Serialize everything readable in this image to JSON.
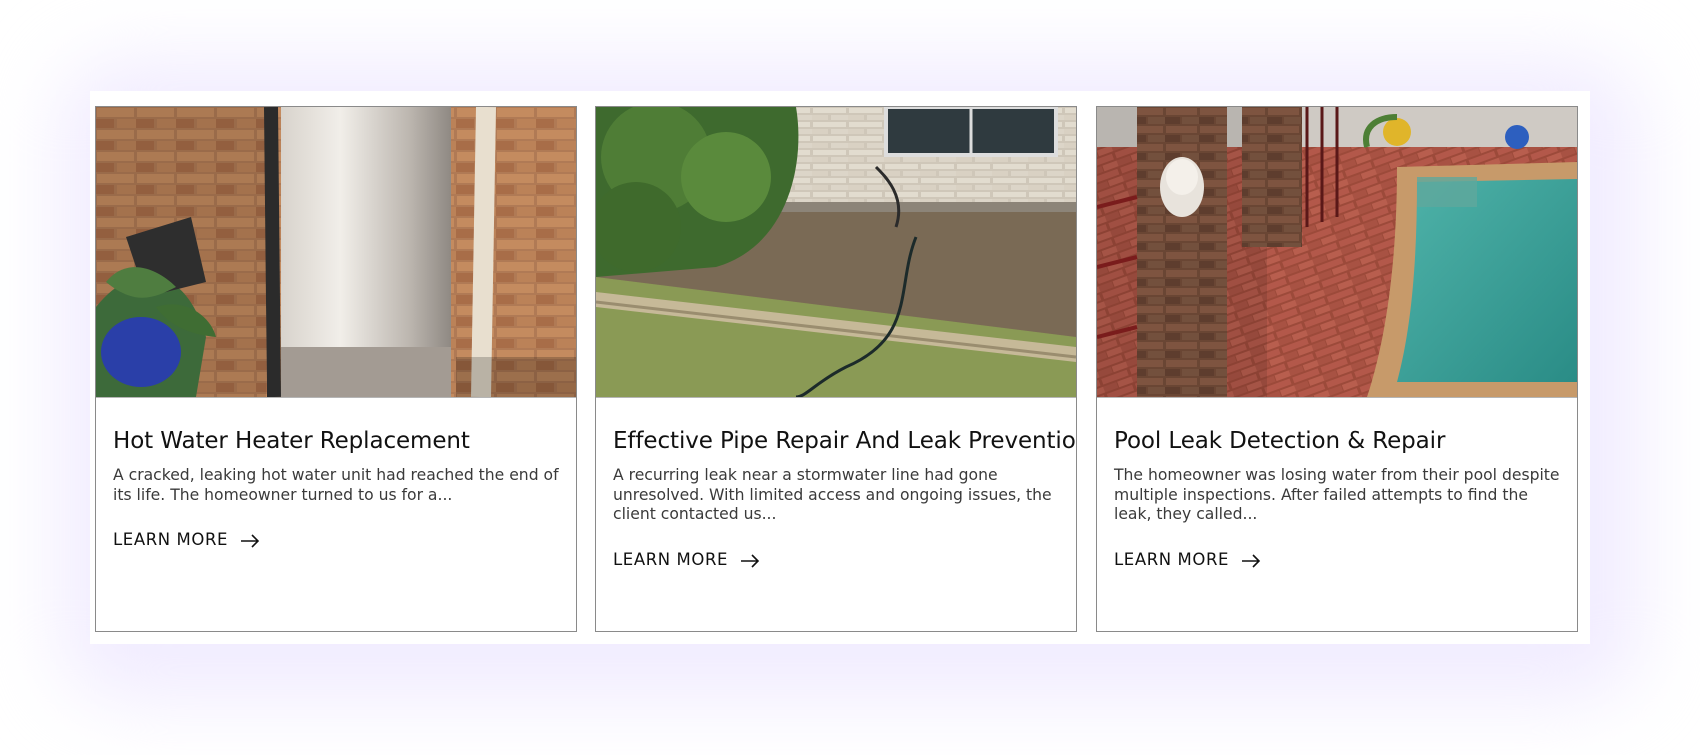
{
  "cards": [
    {
      "title": "Hot Water Heater Replacement",
      "description": "A cracked, leaking hot water unit had reached the end of its life. The homeowner turned to us for a...",
      "link_label": "LEARN MORE",
      "link_icon": "arrow-right-icon",
      "image": "hot-water-heater-photo"
    },
    {
      "title": "Effective Pipe Repair And Leak Prevention",
      "description": "A recurring leak near a stormwater line had gone unresolved. With limited access and ongoing issues, the client contacted us...",
      "link_label": "LEARN MORE",
      "link_icon": "arrow-right-icon",
      "image": "pipe-repair-trench-photo"
    },
    {
      "title": "Pool Leak Detection & Repair",
      "description": "The homeowner was losing water from their pool despite multiple inspections. After failed attempts to find the leak, they called...",
      "link_label": "LEARN MORE",
      "link_icon": "arrow-right-icon",
      "image": "pool-area-photo"
    }
  ],
  "colors": {
    "background_glow": "#f1ecff",
    "card_border": "#8a8a8a",
    "text_primary": "#111111",
    "text_secondary": "#3a3a3a"
  }
}
